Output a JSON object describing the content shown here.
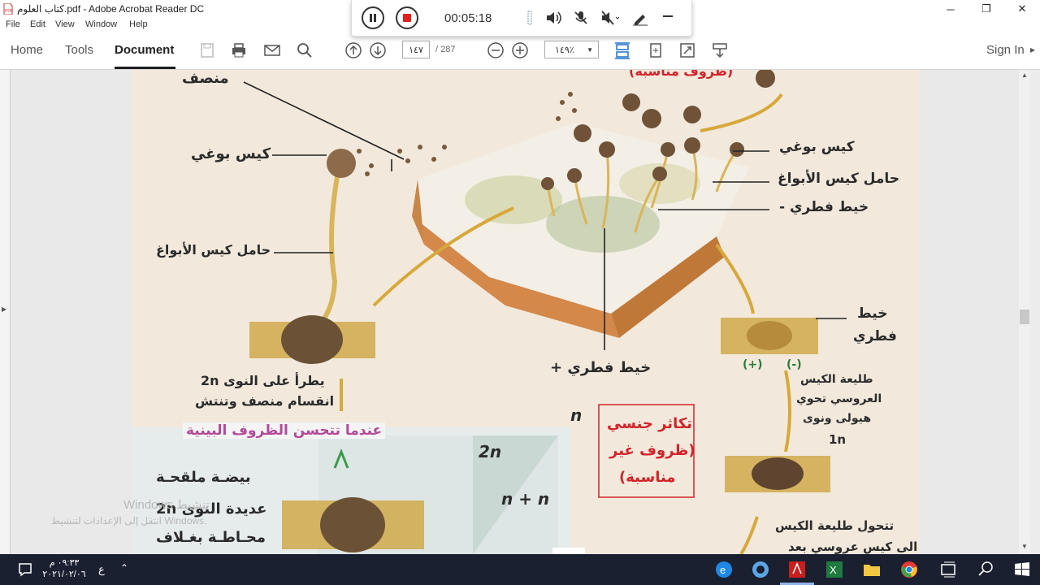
{
  "window": {
    "title": "كتاب العلوم.pdf - Adobe Acrobat Reader DC",
    "controls": {
      "minimize": "─",
      "restore": "❐",
      "close": "✕"
    }
  },
  "menu": [
    "File",
    "Edit",
    "View",
    "Window",
    "Help"
  ],
  "tabs": {
    "home": "Home",
    "tools": "Tools",
    "document": "Document"
  },
  "pagination": {
    "current": "١٤٧",
    "total": "/ 287"
  },
  "zoom": "١٤٩٪",
  "signin": "Sign In",
  "recorder": {
    "elapsed": "00:05:18"
  },
  "labels": {
    "mansif": "منصف",
    "kis_bawghi_left": "كيس بوغي",
    "hamil_left": "حامل كيس الأبواغ",
    "yatraa_1": "يطرأ على النوى 2n",
    "yatraa_2": "انقسام منصف وتنتش",
    "indama": "عندما تتحسن الظروف البينية",
    "bayda_1": "بيضـة ملقحـة",
    "bayda_2": "عديدة النوى 2n",
    "bayda_3": "محـاطـة بغـلاف",
    "top_red": "(ظروف مناسبة)",
    "kis_bawghi_right": "كيس بوغي",
    "hamil_right": "حامل كيس الأبواغ",
    "khayt_right": "خيط فطري -",
    "khayt_plus": "خيط فطري +",
    "khayt_far_1": "خيط",
    "khayt_far_2": "فطري",
    "plus": "(+)",
    "minus": "(-)",
    "taliaa_1": "طليعة الكيس",
    "taliaa_2": "العروسي تحوي",
    "taliaa_3": "هيولى ونوى",
    "taliaa_4": "1n",
    "n": "n",
    "two_n": "2n",
    "n_plus_n": "n + n",
    "takathur_1": "تكاثر جنسي",
    "takathur_2": "(ظروف غير",
    "takathur_3": "مناسبة)",
    "tatahawal_1": "تتحول طليعة الكيس",
    "tatahawal_2": "الى كيس عروسي بعد"
  },
  "watermark": {
    "line1": "Windows تنشيط",
    "line2": "انتقل إلى الإعدادات لتنشيط Windows."
  },
  "taskbar": {
    "time": "٠٩:٣٣ م",
    "date": "٢٠٢١/٠٢/٠٦",
    "lang": "ع"
  }
}
